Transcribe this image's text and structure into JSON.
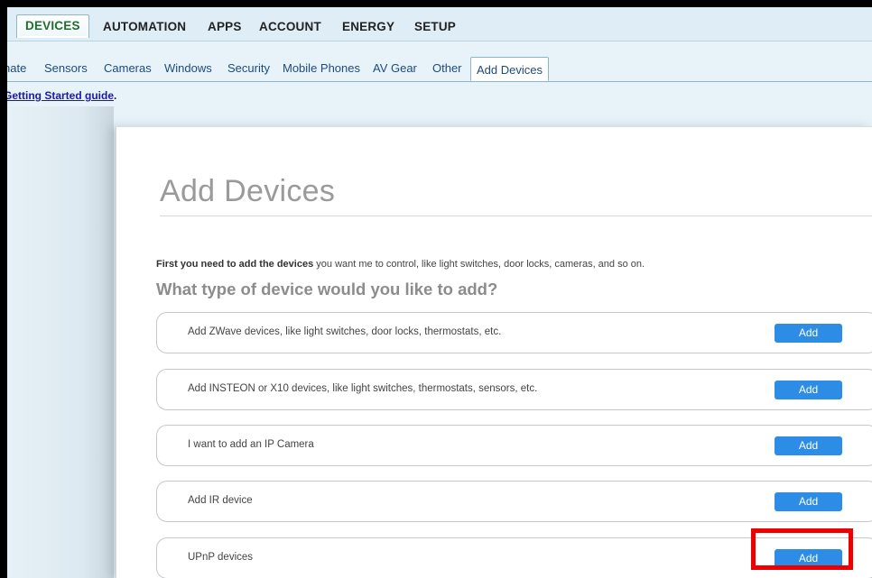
{
  "main_nav": {
    "items": [
      {
        "label": "DEVICES",
        "active": true
      },
      {
        "label": "AUTOMATION"
      },
      {
        "label": "APPS"
      },
      {
        "label": "ACCOUNT"
      },
      {
        "label": "ENERGY"
      },
      {
        "label": "SETUP"
      }
    ]
  },
  "sub_nav": {
    "items": [
      {
        "label": "nate"
      },
      {
        "label": "Sensors"
      },
      {
        "label": "Cameras"
      },
      {
        "label": "Windows"
      },
      {
        "label": "Security"
      },
      {
        "label": "Mobile Phones"
      },
      {
        "label": "AV Gear"
      },
      {
        "label": "Other"
      },
      {
        "label": "Add Devices",
        "active": true
      }
    ]
  },
  "guide": {
    "link": "Getting Started guide",
    "suffix": "."
  },
  "page": {
    "title": "Add Devices",
    "intro_bold": "First you need to add the devices",
    "intro_rest": " you want me to control, like light switches, door locks, cameras, and so on.",
    "question": "What type of device would you like to add?"
  },
  "options": [
    {
      "label": "Add ZWave devices, like light switches, door locks, thermostats, etc.",
      "button": "Add"
    },
    {
      "label": "Add INSTEON or X10 devices, like light switches, thermostats, sensors, etc.",
      "button": "Add"
    },
    {
      "label": "I want to add an IP Camera",
      "button": "Add"
    },
    {
      "label": "Add IR device",
      "button": "Add"
    },
    {
      "label": "UPnP devices",
      "button": "Add"
    }
  ],
  "colors": {
    "accent_button": "#2d8ce6",
    "active_tab_text": "#1f6f2c",
    "link": "#1a1aa6",
    "highlight_box": "#ee0000"
  }
}
